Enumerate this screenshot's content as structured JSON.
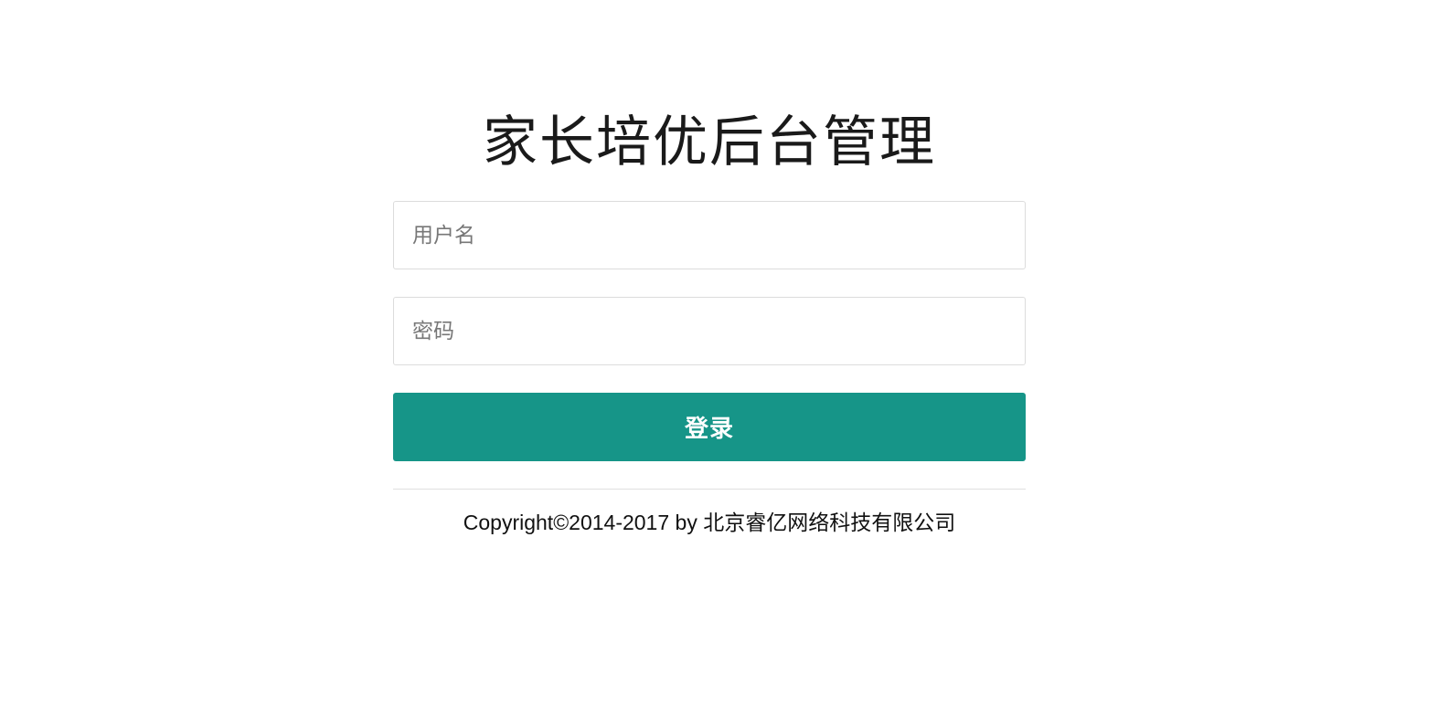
{
  "header": {
    "title": "家长培优后台管理"
  },
  "form": {
    "username_placeholder": "用户名",
    "username_value": "",
    "password_placeholder": "密码",
    "password_value": "",
    "login_label": "登录"
  },
  "footer": {
    "copyright": "Copyright©2014-2017 by 北京睿亿网络科技有限公司"
  },
  "colors": {
    "accent": "#169588",
    "border": "#dcdcdc",
    "divider": "#e0e0e0"
  }
}
